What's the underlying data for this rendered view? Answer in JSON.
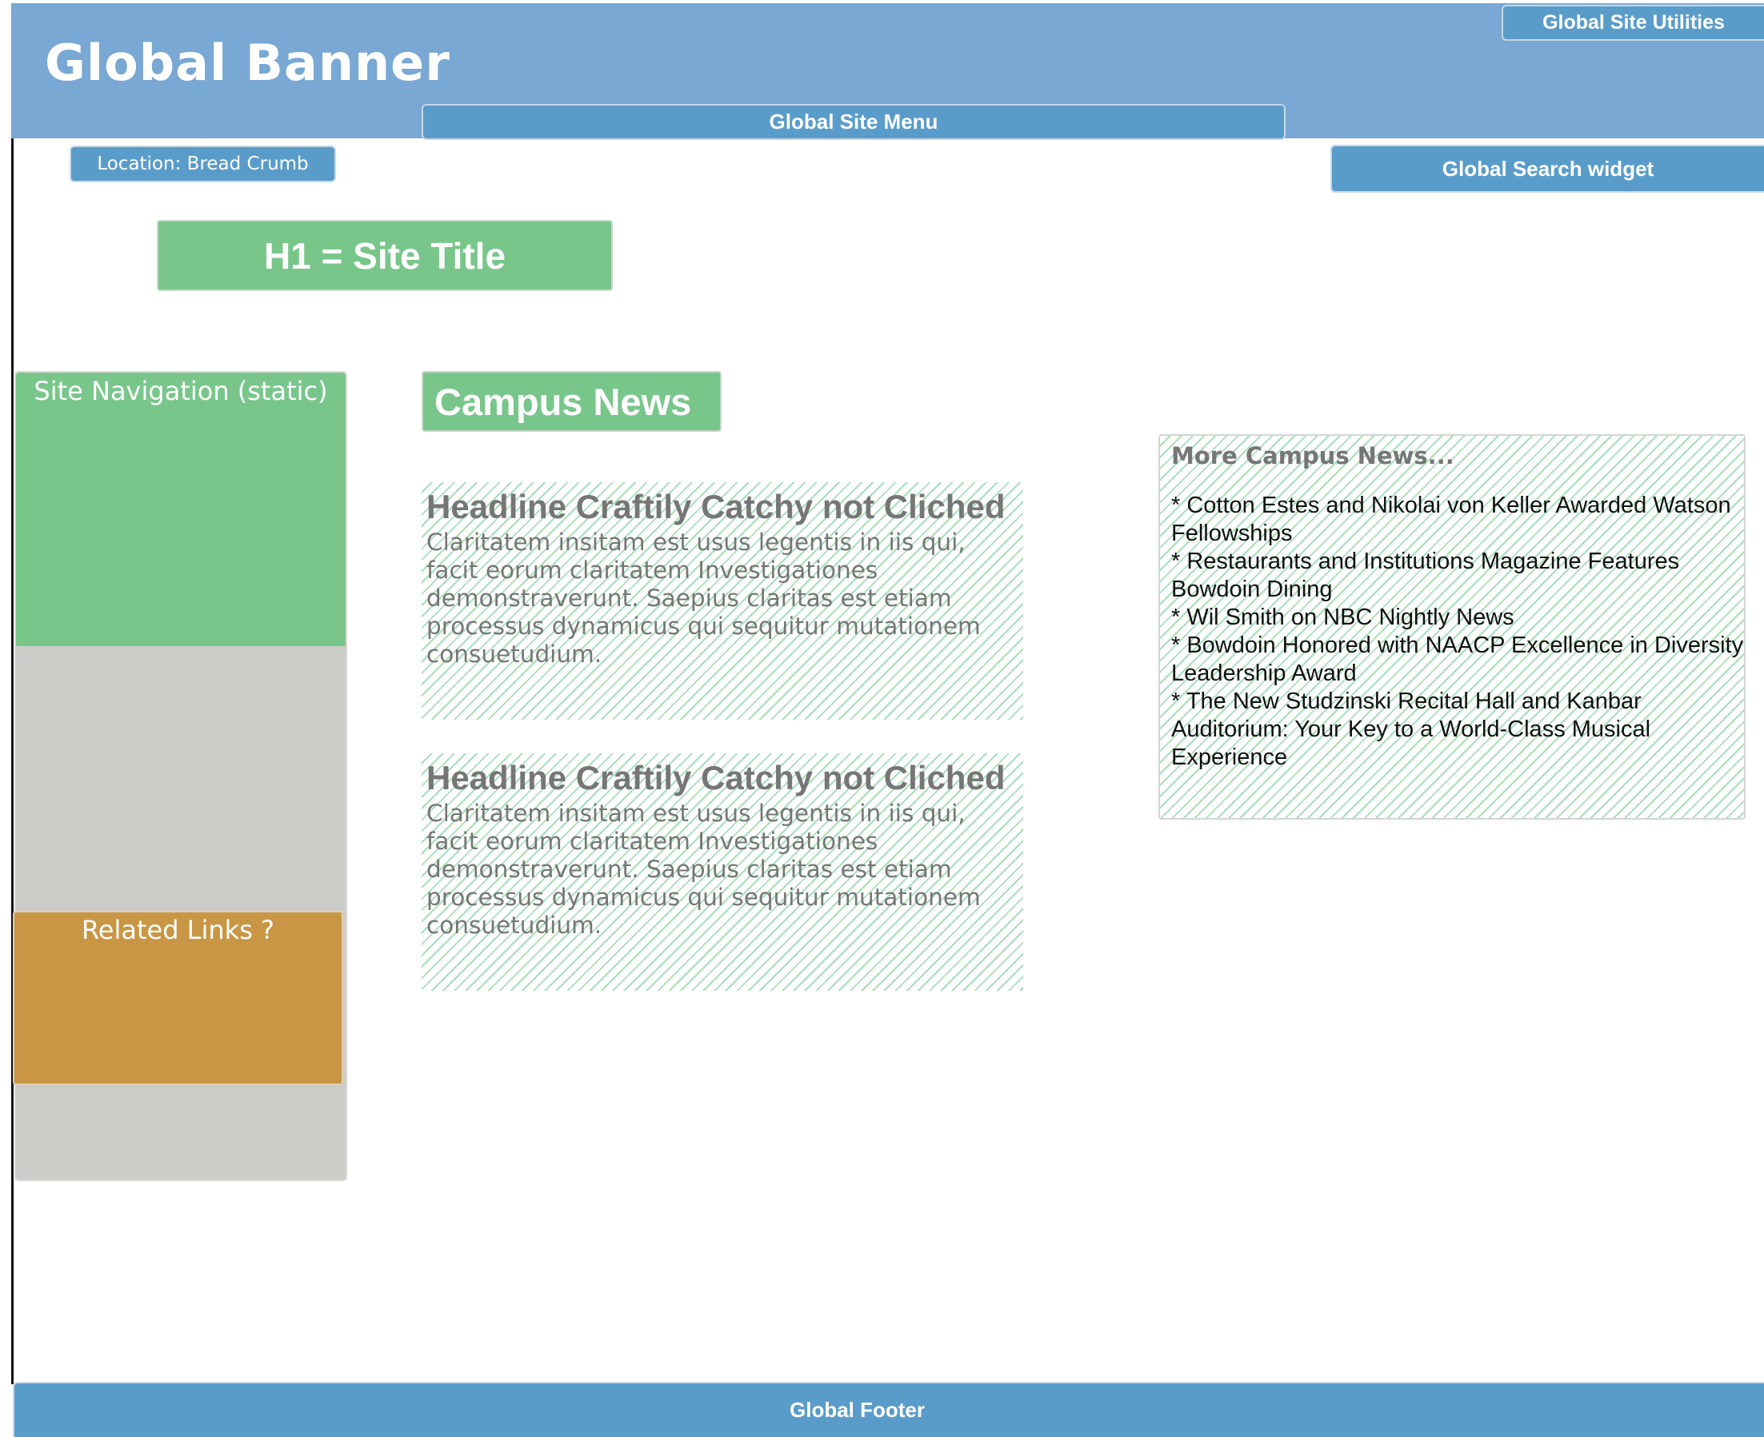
{
  "banner": {
    "title": "Global Banner"
  },
  "utilities": {
    "label": "Global Site Utilities"
  },
  "site_menu": {
    "label": "Global Site Menu"
  },
  "breadcrumb": {
    "label": "Location: Bread Crumb"
  },
  "search": {
    "label": "Global Search widget"
  },
  "site_title": {
    "label": "H1 = Site Title"
  },
  "sidebar": {
    "nav_label": "Site Navigation (static)",
    "related_label": "Related Links ?"
  },
  "main": {
    "section_title": "Campus News",
    "articles": [
      {
        "headline": "Headline Craftily Catchy not Cliched",
        "lines": [
          "Claritatem insitam est usus legentis in iis qui,",
          "facit eorum claritatem Investigationes",
          "demonstraverunt. Saepius claritas est etiam",
          "processus dynamicus qui sequitur mutationem",
          "consuetudium."
        ]
      },
      {
        "headline": "Headline Craftily Catchy not Cliched",
        "lines": [
          "Claritatem insitam est usus legentis in iis qui,",
          "facit eorum claritatem Investigationes",
          "demonstraverunt. Saepius claritas est etiam",
          "processus dynamicus qui sequitur mutationem",
          "consuetudium."
        ]
      }
    ]
  },
  "more_news": {
    "title": "More Campus News...",
    "items": [
      "* Cotton Estes and Nikolai von Keller Awarded Watson Fellowships",
      "* Restaurants and Institutions Magazine Features Bowdoin Dining",
      "* Wil Smith on NBC Nightly News",
      "* Bowdoin Honored with NAACP Excellence in Diversity Leadership Award",
      "* The New Studzinski Recital Hall and Kanbar Auditorium: Your Key to a World-Class Musical Experience"
    ]
  },
  "footer": {
    "label": "Global Footer"
  },
  "colors": {
    "banner": "#78a8d3",
    "widget_blue": "#5a9cc9",
    "green": "#79c68b",
    "sidebar_gray": "#cbcbc7",
    "related_orange": "#c89644",
    "hatch_green": "#a8dfb8"
  }
}
